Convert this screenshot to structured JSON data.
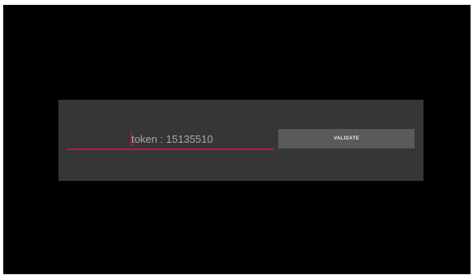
{
  "token_field": {
    "value": "token : 15135510"
  },
  "validate_button": {
    "label": "VALIDATE"
  },
  "colors": {
    "background": "#000000",
    "dialog": "#353637",
    "accent": "#b01a51",
    "button": "#5a5a5a"
  }
}
